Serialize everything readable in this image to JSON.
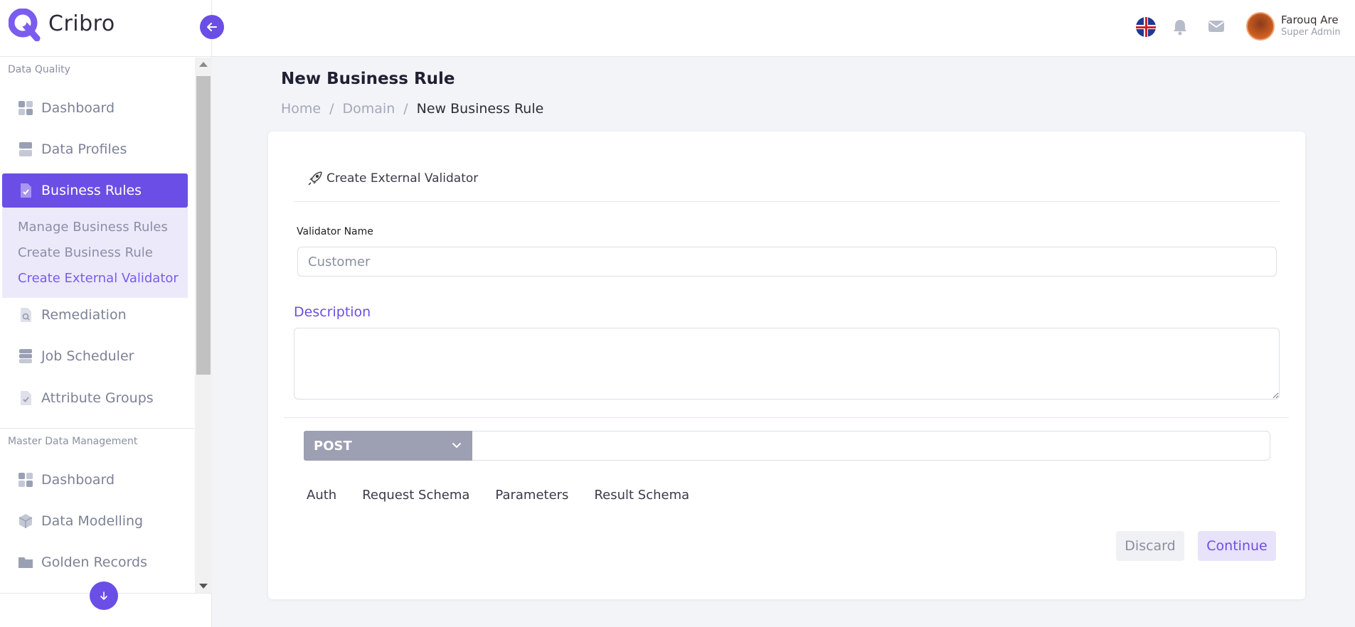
{
  "brand": {
    "name": "Cribro",
    "accent": "#6b4ee6"
  },
  "user": {
    "name": "Farouq Are",
    "role": "Super Admin"
  },
  "sidebar": {
    "sections": [
      {
        "label": "Data Quality"
      },
      {
        "label": "Master Data Management"
      }
    ],
    "dq_items": [
      {
        "label": "Dashboard",
        "icon": "dashboard-icon"
      },
      {
        "label": "Data Profiles",
        "icon": "database-icon"
      },
      {
        "label": "Business Rules",
        "icon": "document-check-icon",
        "active": true
      },
      {
        "label": "Remediation",
        "icon": "document-search-icon"
      },
      {
        "label": "Job Scheduler",
        "icon": "database-icon"
      },
      {
        "label": "Attribute Groups",
        "icon": "document-check-icon"
      }
    ],
    "submenu": [
      {
        "label": "Manage Business Rules"
      },
      {
        "label": "Create Business Rule"
      },
      {
        "label": "Create External Validator",
        "current": true
      }
    ],
    "mdm_items": [
      {
        "label": "Dashboard",
        "icon": "dashboard-icon"
      },
      {
        "label": "Data Modelling",
        "icon": "cube-icon"
      },
      {
        "label": "Golden Records",
        "icon": "folder-icon"
      }
    ]
  },
  "page": {
    "title": "New Business Rule",
    "breadcrumb": [
      "Home",
      "/",
      "Domain",
      "/",
      "New Business Rule"
    ]
  },
  "form": {
    "header": "Create External Validator",
    "validator_label": "Validator Name",
    "validator_placeholder": "Customer",
    "description_label": "Description",
    "method": "POST",
    "url_value": "",
    "tabs": [
      "Auth",
      "Request Schema",
      "Parameters",
      "Result Schema"
    ],
    "discard_label": "Discard",
    "continue_label": "Continue"
  }
}
